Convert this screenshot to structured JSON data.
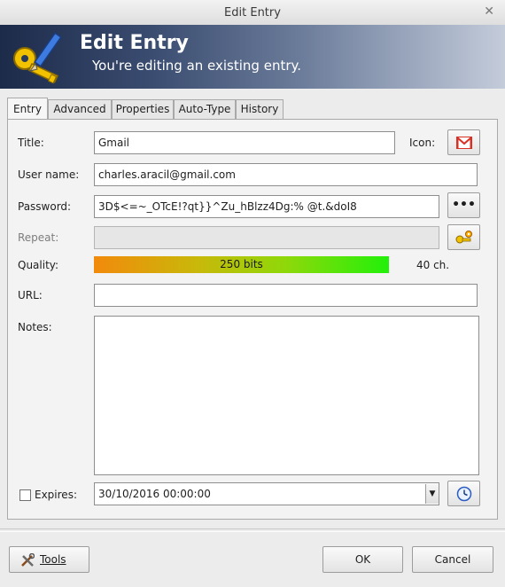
{
  "window": {
    "title": "Edit Entry",
    "close_glyph": "✕"
  },
  "banner": {
    "title": "Edit Entry",
    "subtitle": "You're editing an existing entry.",
    "icon": "key-pen-icon"
  },
  "tabs": [
    {
      "label": "Entry",
      "active": true
    },
    {
      "label": "Advanced",
      "active": false
    },
    {
      "label": "Properties",
      "active": false
    },
    {
      "label": "Auto-Type",
      "active": false
    },
    {
      "label": "History",
      "active": false
    }
  ],
  "fields": {
    "title_label": "Title:",
    "title_value": "Gmail",
    "icon_label": "Icon:",
    "icon_name": "gmail-icon",
    "username_label": "User name:",
    "username_value": "charles.aracil@gmail.com",
    "password_label": "Password:",
    "password_value": "3D$<=~_OTcE!?qt}}^Zu_hBlzz4Dg:% @t.&doI8",
    "password_toggle_label": "•••",
    "repeat_label": "Repeat:",
    "repeat_value": "",
    "quality_label": "Quality:",
    "quality_text": "250 bits",
    "quality_fill": 1.0,
    "quality_chars": "40 ch.",
    "url_label": "URL:",
    "url_value": "",
    "notes_label": "Notes:",
    "notes_value": "",
    "expires_label": "Expires:",
    "expires_checked": false,
    "expires_value": "30/10/2016 00:00:00"
  },
  "footer": {
    "tools_label": "Tools",
    "ok_label": "OK",
    "cancel_label": "Cancel"
  },
  "colors": {
    "banner_dark": "#1d2b4a",
    "gmail_red": "#d93025",
    "quality_start": "#f28a0c",
    "quality_end": "#22f00a"
  }
}
